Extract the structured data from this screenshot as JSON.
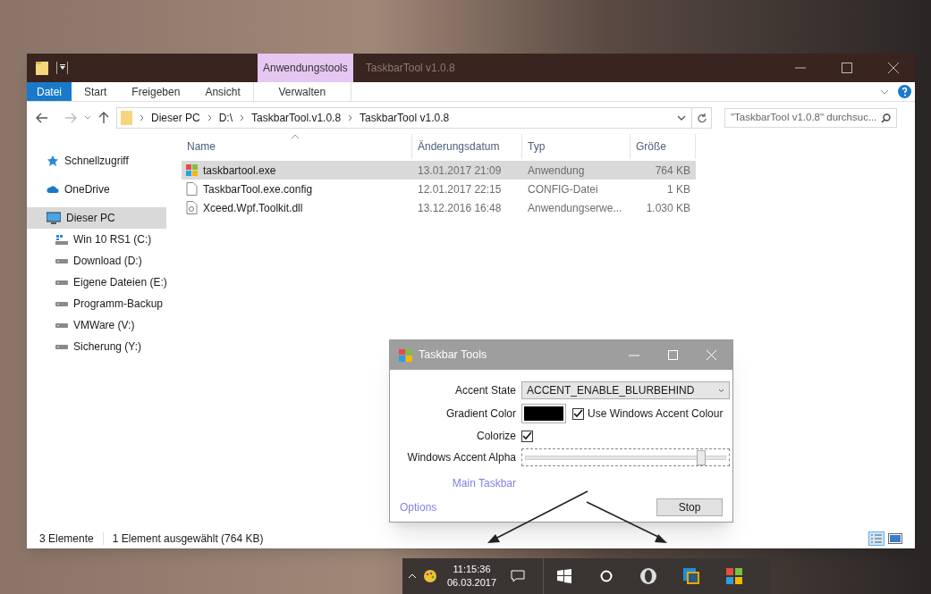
{
  "explorer": {
    "contextual_tab": "Anwendungstools",
    "title": "TaskbarTool v1.0.8",
    "ribbon_tabs": [
      {
        "label": "Datei",
        "kind": "file",
        "selected": false
      },
      {
        "label": "Start",
        "kind": "tab",
        "selected": false
      },
      {
        "label": "Freigeben",
        "kind": "tab",
        "selected": false
      },
      {
        "label": "Ansicht",
        "kind": "tab",
        "selected": false
      },
      {
        "label": "Verwalten",
        "kind": "contextual",
        "selected": false
      }
    ],
    "breadcrumb": [
      "Dieser PC",
      "D:\\",
      "TaskbarTool.v1.0.8",
      "TaskbarTool v1.0.8"
    ],
    "search": {
      "placeholder": "\"TaskbarTool v1.0.8\" durchsuc..."
    },
    "nav": [
      {
        "label": "Schnellzugriff",
        "kind": "star",
        "selected": false
      },
      {
        "label": "OneDrive",
        "kind": "cloud",
        "selected": false
      },
      {
        "label": "Dieser PC",
        "kind": "pc",
        "selected": true,
        "children": [
          {
            "label": "Win 10 RS1 (C:)",
            "kind": "windrive",
            "selected": false
          },
          {
            "label": "Download (D:)",
            "kind": "drive",
            "selected": false
          },
          {
            "label": "Eigene Dateien (E:)",
            "kind": "drive",
            "selected": false
          },
          {
            "label": "Programm-Backup",
            "kind": "drive",
            "selected": false
          },
          {
            "label": "VMWare (V:)",
            "kind": "drive",
            "selected": false
          },
          {
            "label": "Sicherung (Y:)",
            "kind": "drive",
            "selected": false
          }
        ]
      }
    ],
    "columns": [
      "Name",
      "Änderungsdatum",
      "Typ",
      "Größe"
    ],
    "rows": [
      {
        "kind": "app",
        "name": "taskbartool.exe",
        "date": "13.01.2017 21:09",
        "type": "Anwendung",
        "size": "764 KB",
        "selected": true
      },
      {
        "kind": "file",
        "name": "TaskbarTool.exe.config",
        "date": "12.01.2017 22:15",
        "type": "CONFIG-Datei",
        "size": "1 KB",
        "selected": false
      },
      {
        "kind": "dll",
        "name": "Xceed.Wpf.Toolkit.dll",
        "date": "13.12.2016 16:48",
        "type": "Anwendungserwe...",
        "size": "1.030 KB",
        "selected": false
      }
    ],
    "status_bar": [
      "3 Elemente",
      "1 Element ausgewählt (764 KB)"
    ]
  },
  "dialog": {
    "title": "Taskbar Tools",
    "accent_state": {
      "label": "Accent State",
      "value": "ACCENT_ENABLE_BLURBEHIND"
    },
    "gradient_color": {
      "label": "Gradient Color",
      "color": "#000000"
    },
    "use_accent": {
      "label": "Use Windows Accent Colour",
      "checked": true
    },
    "colorize": {
      "label": "Colorize",
      "checked": true
    },
    "alpha": {
      "label": "Windows Accent Alpha",
      "level": 0.88
    },
    "link": "Main Taskbar",
    "options": "Options",
    "button": "Stop"
  },
  "taskbar": {
    "time": "11:15:36",
    "date": "06.03.2017"
  }
}
